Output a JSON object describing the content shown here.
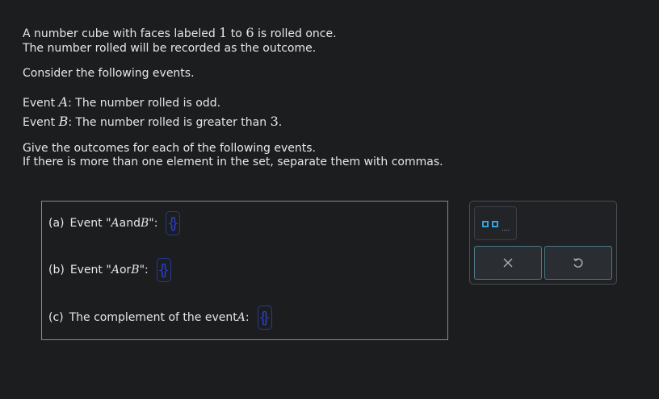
{
  "problem": {
    "p1_pre": "A number cube with faces labeled ",
    "p1_n1": "1",
    "p1_mid": " to ",
    "p1_n2": "6",
    "p1_post": " is rolled once.",
    "p2": "The number rolled will be recorded as the outcome.",
    "p3": "Consider the following events.",
    "eventA_prefix": "Event ",
    "eventA_var": "A",
    "eventA_text": ": The number rolled is odd.",
    "eventB_prefix": "Event ",
    "eventB_var": "B",
    "eventB_text": ": The number rolled is greater than ",
    "eventB_num": "3",
    "eventB_end": ".",
    "instr1": "Give the outcomes for each of the following events.",
    "instr2": "If there is more than one element in the set, separate them with commas."
  },
  "parts": {
    "a": {
      "tag": "(a)",
      "pre": "Event \"",
      "v1": "A",
      "conj": " and ",
      "v2": "B",
      "post": "\":",
      "value": ""
    },
    "b": {
      "tag": "(b)",
      "pre": "Event \"",
      "v1": "A",
      "conj": " or ",
      "v2": "B",
      "post": "\":",
      "value": ""
    },
    "c": {
      "tag": "(c)",
      "pre": "The complement of the event ",
      "v1": "A",
      "post": ":",
      "value": ""
    }
  },
  "tools": {
    "template_icon": "set-list-template-icon",
    "clear_icon": "x-icon",
    "undo_icon": "undo-icon",
    "accent": "#3ba0d8",
    "button_border": "#4b7a84"
  }
}
